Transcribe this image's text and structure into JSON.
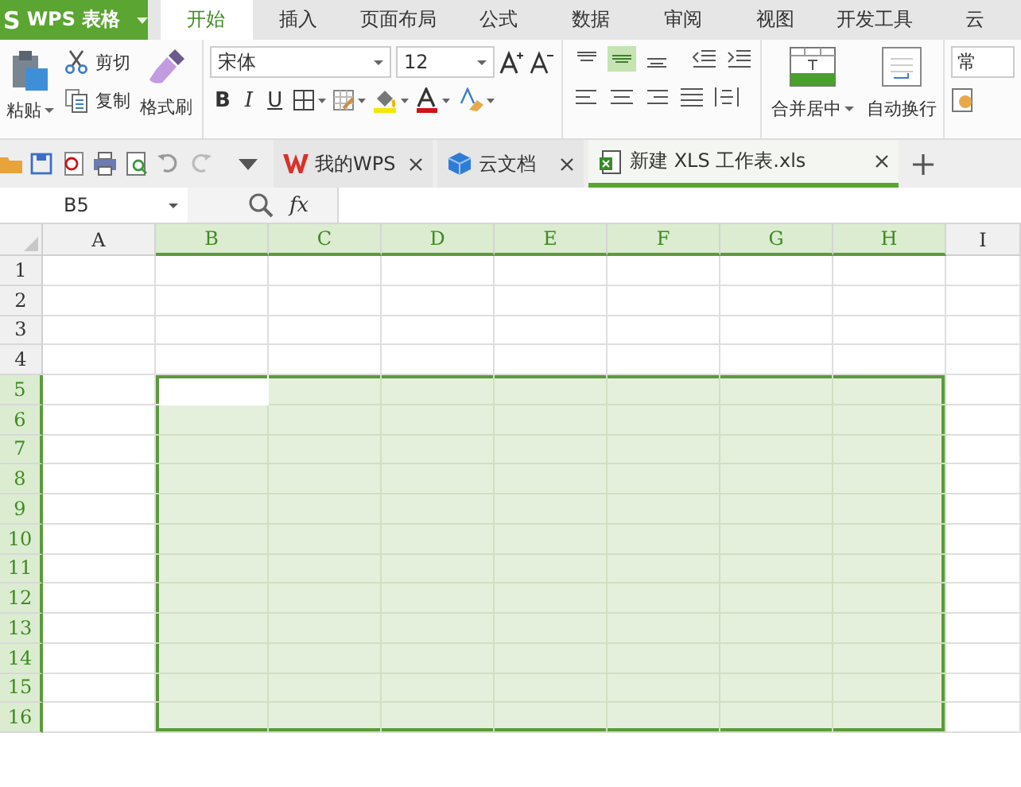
{
  "app": {
    "logo": "S",
    "title": "WPS 表格"
  },
  "ribbon_tabs": [
    {
      "label": "开始",
      "selected": true
    },
    {
      "label": "插入",
      "selected": false
    },
    {
      "label": "页面布局",
      "selected": false
    },
    {
      "label": "公式",
      "selected": false
    },
    {
      "label": "数据",
      "selected": false
    },
    {
      "label": "审阅",
      "selected": false
    },
    {
      "label": "视图",
      "selected": false
    },
    {
      "label": "开发工具",
      "selected": false
    },
    {
      "label": "云",
      "selected": false
    }
  ],
  "clipboard": {
    "paste": "粘贴",
    "cut": "剪切",
    "copy": "复制",
    "format_painter": "格式刷"
  },
  "font": {
    "name": "宋体",
    "size": "12",
    "bold": "B",
    "italic": "I",
    "underline": "U"
  },
  "merge": {
    "merge_center": "合并居中",
    "wrap_text": "自动换行"
  },
  "number_format": {
    "value": "常"
  },
  "doc_tabs": [
    {
      "label": "我的WPS",
      "kind": "wps",
      "selected": false
    },
    {
      "label": "云文档",
      "kind": "cloud",
      "selected": false
    },
    {
      "label": "新建 XLS 工作表.xls",
      "kind": "sheet",
      "selected": true
    }
  ],
  "formula_bar": {
    "name_box": "B5",
    "fx": "fx"
  },
  "columns": [
    {
      "label": "A",
      "selected": false
    },
    {
      "label": "B",
      "selected": true
    },
    {
      "label": "C",
      "selected": true
    },
    {
      "label": "D",
      "selected": true
    },
    {
      "label": "E",
      "selected": true
    },
    {
      "label": "F",
      "selected": true
    },
    {
      "label": "G",
      "selected": true
    },
    {
      "label": "H",
      "selected": true
    },
    {
      "label": "I",
      "selected": false
    }
  ],
  "rows": [
    {
      "label": "1",
      "selected": false,
      "cells": [
        {
          "selected": false,
          "active": false
        },
        {
          "selected": false,
          "active": false
        },
        {
          "selected": false,
          "active": false
        },
        {
          "selected": false,
          "active": false
        },
        {
          "selected": false,
          "active": false
        },
        {
          "selected": false,
          "active": false
        },
        {
          "selected": false,
          "active": false
        },
        {
          "selected": false,
          "active": false
        },
        {
          "selected": false,
          "active": false
        }
      ]
    },
    {
      "label": "2",
      "selected": false,
      "cells": [
        {
          "selected": false,
          "active": false
        },
        {
          "selected": false,
          "active": false
        },
        {
          "selected": false,
          "active": false
        },
        {
          "selected": false,
          "active": false
        },
        {
          "selected": false,
          "active": false
        },
        {
          "selected": false,
          "active": false
        },
        {
          "selected": false,
          "active": false
        },
        {
          "selected": false,
          "active": false
        },
        {
          "selected": false,
          "active": false
        }
      ]
    },
    {
      "label": "3",
      "selected": false,
      "cells": [
        {
          "selected": false,
          "active": false
        },
        {
          "selected": false,
          "active": false
        },
        {
          "selected": false,
          "active": false
        },
        {
          "selected": false,
          "active": false
        },
        {
          "selected": false,
          "active": false
        },
        {
          "selected": false,
          "active": false
        },
        {
          "selected": false,
          "active": false
        },
        {
          "selected": false,
          "active": false
        },
        {
          "selected": false,
          "active": false
        }
      ]
    },
    {
      "label": "4",
      "selected": false,
      "cells": [
        {
          "selected": false,
          "active": false
        },
        {
          "selected": false,
          "active": false
        },
        {
          "selected": false,
          "active": false
        },
        {
          "selected": false,
          "active": false
        },
        {
          "selected": false,
          "active": false
        },
        {
          "selected": false,
          "active": false
        },
        {
          "selected": false,
          "active": false
        },
        {
          "selected": false,
          "active": false
        },
        {
          "selected": false,
          "active": false
        }
      ]
    },
    {
      "label": "5",
      "selected": true,
      "cells": [
        {
          "selected": false,
          "active": false
        },
        {
          "selected": true,
          "active": true
        },
        {
          "selected": true,
          "active": false
        },
        {
          "selected": true,
          "active": false
        },
        {
          "selected": true,
          "active": false
        },
        {
          "selected": true,
          "active": false
        },
        {
          "selected": true,
          "active": false
        },
        {
          "selected": true,
          "active": false
        },
        {
          "selected": false,
          "active": false
        }
      ]
    },
    {
      "label": "6",
      "selected": true,
      "cells": [
        {
          "selected": false,
          "active": false
        },
        {
          "selected": true,
          "active": false
        },
        {
          "selected": true,
          "active": false
        },
        {
          "selected": true,
          "active": false
        },
        {
          "selected": true,
          "active": false
        },
        {
          "selected": true,
          "active": false
        },
        {
          "selected": true,
          "active": false
        },
        {
          "selected": true,
          "active": false
        },
        {
          "selected": false,
          "active": false
        }
      ]
    },
    {
      "label": "7",
      "selected": true,
      "cells": [
        {
          "selected": false,
          "active": false
        },
        {
          "selected": true,
          "active": false
        },
        {
          "selected": true,
          "active": false
        },
        {
          "selected": true,
          "active": false
        },
        {
          "selected": true,
          "active": false
        },
        {
          "selected": true,
          "active": false
        },
        {
          "selected": true,
          "active": false
        },
        {
          "selected": true,
          "active": false
        },
        {
          "selected": false,
          "active": false
        }
      ]
    },
    {
      "label": "8",
      "selected": true,
      "cells": [
        {
          "selected": false,
          "active": false
        },
        {
          "selected": true,
          "active": false
        },
        {
          "selected": true,
          "active": false
        },
        {
          "selected": true,
          "active": false
        },
        {
          "selected": true,
          "active": false
        },
        {
          "selected": true,
          "active": false
        },
        {
          "selected": true,
          "active": false
        },
        {
          "selected": true,
          "active": false
        },
        {
          "selected": false,
          "active": false
        }
      ]
    },
    {
      "label": "9",
      "selected": true,
      "cells": [
        {
          "selected": false,
          "active": false
        },
        {
          "selected": true,
          "active": false
        },
        {
          "selected": true,
          "active": false
        },
        {
          "selected": true,
          "active": false
        },
        {
          "selected": true,
          "active": false
        },
        {
          "selected": true,
          "active": false
        },
        {
          "selected": true,
          "active": false
        },
        {
          "selected": true,
          "active": false
        },
        {
          "selected": false,
          "active": false
        }
      ]
    },
    {
      "label": "10",
      "selected": true,
      "cells": [
        {
          "selected": false,
          "active": false
        },
        {
          "selected": true,
          "active": false
        },
        {
          "selected": true,
          "active": false
        },
        {
          "selected": true,
          "active": false
        },
        {
          "selected": true,
          "active": false
        },
        {
          "selected": true,
          "active": false
        },
        {
          "selected": true,
          "active": false
        },
        {
          "selected": true,
          "active": false
        },
        {
          "selected": false,
          "active": false
        }
      ]
    },
    {
      "label": "11",
      "selected": true,
      "cells": [
        {
          "selected": false,
          "active": false
        },
        {
          "selected": true,
          "active": false
        },
        {
          "selected": true,
          "active": false
        },
        {
          "selected": true,
          "active": false
        },
        {
          "selected": true,
          "active": false
        },
        {
          "selected": true,
          "active": false
        },
        {
          "selected": true,
          "active": false
        },
        {
          "selected": true,
          "active": false
        },
        {
          "selected": false,
          "active": false
        }
      ]
    },
    {
      "label": "12",
      "selected": true,
      "cells": [
        {
          "selected": false,
          "active": false
        },
        {
          "selected": true,
          "active": false
        },
        {
          "selected": true,
          "active": false
        },
        {
          "selected": true,
          "active": false
        },
        {
          "selected": true,
          "active": false
        },
        {
          "selected": true,
          "active": false
        },
        {
          "selected": true,
          "active": false
        },
        {
          "selected": true,
          "active": false
        },
        {
          "selected": false,
          "active": false
        }
      ]
    },
    {
      "label": "13",
      "selected": true,
      "cells": [
        {
          "selected": false,
          "active": false
        },
        {
          "selected": true,
          "active": false
        },
        {
          "selected": true,
          "active": false
        },
        {
          "selected": true,
          "active": false
        },
        {
          "selected": true,
          "active": false
        },
        {
          "selected": true,
          "active": false
        },
        {
          "selected": true,
          "active": false
        },
        {
          "selected": true,
          "active": false
        },
        {
          "selected": false,
          "active": false
        }
      ]
    },
    {
      "label": "14",
      "selected": true,
      "cells": [
        {
          "selected": false,
          "active": false
        },
        {
          "selected": true,
          "active": false
        },
        {
          "selected": true,
          "active": false
        },
        {
          "selected": true,
          "active": false
        },
        {
          "selected": true,
          "active": false
        },
        {
          "selected": true,
          "active": false
        },
        {
          "selected": true,
          "active": false
        },
        {
          "selected": true,
          "active": false
        },
        {
          "selected": false,
          "active": false
        }
      ]
    },
    {
      "label": "15",
      "selected": true,
      "cells": [
        {
          "selected": false,
          "active": false
        },
        {
          "selected": true,
          "active": false
        },
        {
          "selected": true,
          "active": false
        },
        {
          "selected": true,
          "active": false
        },
        {
          "selected": true,
          "active": false
        },
        {
          "selected": true,
          "active": false
        },
        {
          "selected": true,
          "active": false
        },
        {
          "selected": true,
          "active": false
        },
        {
          "selected": false,
          "active": false
        }
      ]
    },
    {
      "label": "16",
      "selected": true,
      "cells": [
        {
          "selected": false,
          "active": false
        },
        {
          "selected": true,
          "active": false
        },
        {
          "selected": true,
          "active": false
        },
        {
          "selected": true,
          "active": false
        },
        {
          "selected": true,
          "active": false
        },
        {
          "selected": true,
          "active": false
        },
        {
          "selected": true,
          "active": false
        },
        {
          "selected": true,
          "active": false
        },
        {
          "selected": false,
          "active": false
        }
      ]
    }
  ]
}
